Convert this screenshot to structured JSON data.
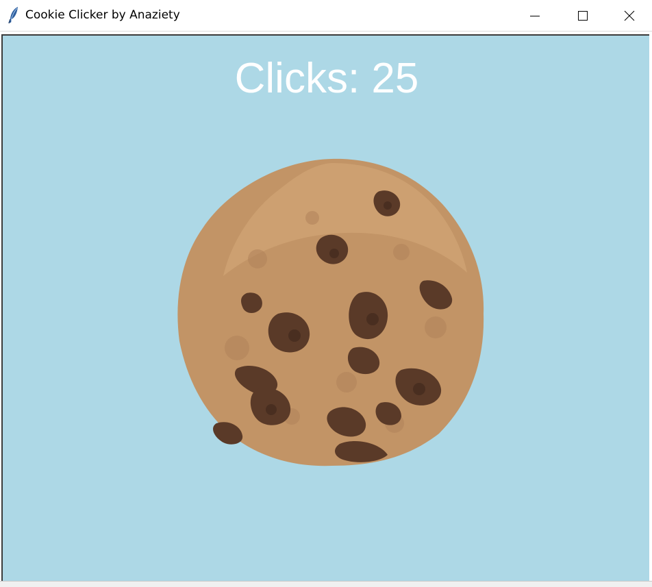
{
  "window": {
    "title": "Cookie Clicker by Anaziety",
    "icon": "feather-icon",
    "controls": {
      "minimize_icon": "minimize-icon",
      "maximize_icon": "maximize-icon",
      "close_icon": "close-icon"
    }
  },
  "game": {
    "clicks_label": "Clicks: 25",
    "cookie_icon": "cookie-icon",
    "background_color": "#add8e6",
    "text_color": "#ffffff"
  }
}
